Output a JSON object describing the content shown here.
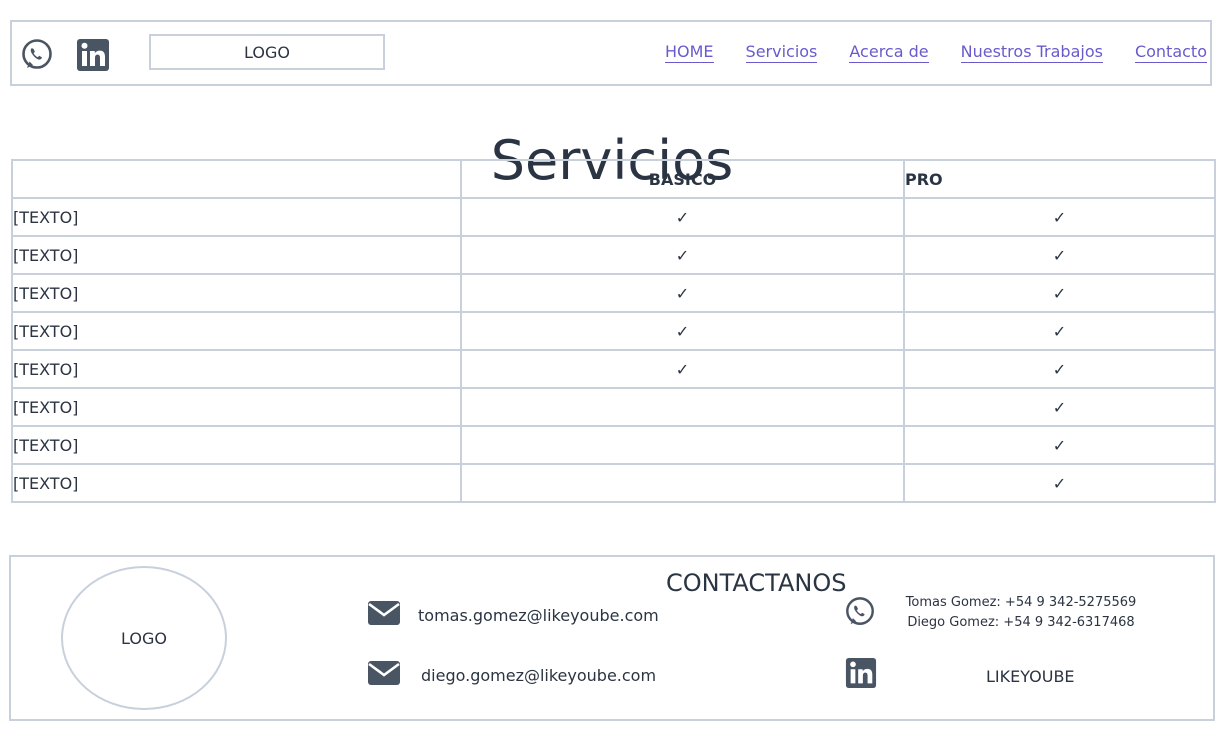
{
  "header": {
    "logo_label": "LOGO",
    "nav": [
      "HOME",
      "Servicios",
      "Acerca de",
      "Nuestros Trabajos",
      "Contacto"
    ]
  },
  "page": {
    "title": "Servicios"
  },
  "pricing": {
    "columns": [
      "",
      "BASICO",
      "PRO"
    ],
    "check_mark": "✓",
    "rows": [
      {
        "label": "[TEXTO]",
        "basic": true,
        "pro": true
      },
      {
        "label": "[TEXTO]",
        "basic": true,
        "pro": true
      },
      {
        "label": "[TEXTO]",
        "basic": true,
        "pro": true
      },
      {
        "label": "[TEXTO]",
        "basic": true,
        "pro": true
      },
      {
        "label": "[TEXTO]",
        "basic": true,
        "pro": true
      },
      {
        "label": "[TEXTO]",
        "basic": false,
        "pro": true
      },
      {
        "label": "[TEXTO]",
        "basic": false,
        "pro": true
      },
      {
        "label": "[TEXTO]",
        "basic": false,
        "pro": true
      }
    ]
  },
  "footer": {
    "logo_label": "LOGO",
    "contact_title": "CONTACTANOS",
    "emails": [
      "tomas.gomez@likeyoube.com",
      "diego.gomez@likeyoube.com"
    ],
    "phones": [
      "Tomas Gomez: +54 9 342-5275569",
      "Diego Gomez: +54 9 342-6317468"
    ],
    "brand": "LIKEYOUBE"
  },
  "icons": {
    "whatsapp": "whatsapp-icon",
    "linkedin": "linkedin-icon",
    "mail": "mail-icon"
  },
  "colors": {
    "text": "#2b3442",
    "link": "#6a5acd",
    "border": "#c8d0dc",
    "icon": "#4a5563"
  }
}
